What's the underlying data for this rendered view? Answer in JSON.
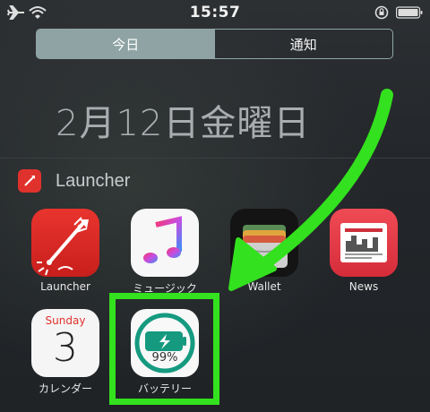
{
  "status_bar": {
    "time": "15:57"
  },
  "tabs": [
    {
      "label": "今日",
      "active": true
    },
    {
      "label": "通知",
      "active": false
    }
  ],
  "date_heading": "2月12日金曜日",
  "widget": {
    "title": "Launcher"
  },
  "apps": [
    {
      "label": "Launcher"
    },
    {
      "label": "ミュージック"
    },
    {
      "label": "Wallet"
    },
    {
      "label": "News"
    },
    {
      "label": "カレンダー",
      "calendar_weekday": "Sunday",
      "calendar_day": "3"
    },
    {
      "label": "バッテリー",
      "battery_level": "99%"
    }
  ],
  "colors": {
    "highlight": "#33e11e",
    "arrow": "#33e11e",
    "battery_teal": "#159a80"
  }
}
